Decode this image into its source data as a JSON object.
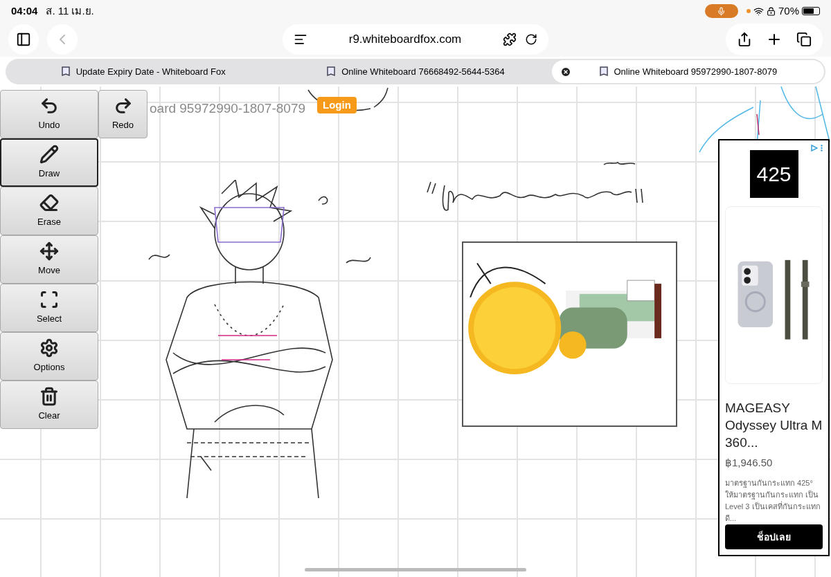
{
  "status_bar": {
    "time": "04:04",
    "date": "ส. 11 เม.ย.",
    "mic_active": true,
    "battery": "70%"
  },
  "browser": {
    "url": "r9.whiteboardfox.com",
    "tabs": [
      {
        "title": "Update Expiry Date - Whiteboard Fox",
        "selected": false
      },
      {
        "title": "Online Whiteboard 76668492-5644-5364",
        "selected": false
      },
      {
        "title": "Online Whiteboard 95972990-1807-8079",
        "selected": true
      }
    ]
  },
  "page": {
    "board_title": "oard 95972990-1807-8079",
    "login": "Login",
    "history": [
      {
        "label": "Undo",
        "kind": "undo"
      },
      {
        "label": "Redo",
        "kind": "redo"
      }
    ],
    "tools": [
      {
        "label": "Draw",
        "kind": "draw",
        "selected": true
      },
      {
        "label": "Erase",
        "kind": "erase",
        "selected": false
      },
      {
        "label": "Move",
        "kind": "move",
        "selected": false
      },
      {
        "label": "Select",
        "kind": "select",
        "selected": false
      },
      {
        "label": "Options",
        "kind": "options",
        "selected": false
      },
      {
        "label": "Clear",
        "kind": "clear",
        "selected": false
      }
    ]
  },
  "ad": {
    "logo": "425",
    "title": "MAGEASY Odyssey Ultra M 360...",
    "price": "฿1,946.50",
    "description": "มาตรฐานกันกระแทก 425° ให้มาตรฐานกันกระแทก เป็น Level 3 เป็นเคสที่กันกระแทกดี...",
    "button": "ช็อปเลย"
  }
}
